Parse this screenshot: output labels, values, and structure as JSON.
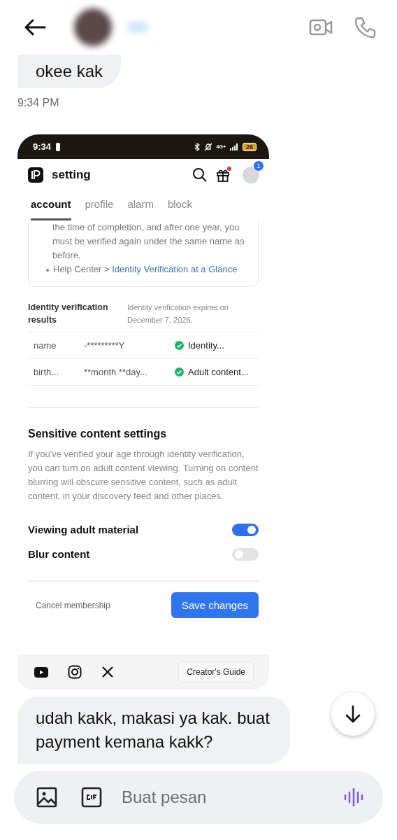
{
  "messages": [
    {
      "kind": "text",
      "text": "okee kak",
      "cut_top": true
    },
    {
      "kind": "time",
      "text": "9:34 PM"
    },
    {
      "kind": "screenshot"
    },
    {
      "kind": "text",
      "text": "udah kakk, makasi ya kak. buat payment kemana kakk?",
      "cut_top": false
    }
  ],
  "screenshot": {
    "status_bar": {
      "time": "9:34",
      "network": "4G+",
      "battery": "26"
    },
    "app_bar": {
      "title": "setting",
      "gift_notification": true,
      "profile_badge": "1"
    },
    "tabs": [
      {
        "label": "account",
        "selected": true
      },
      {
        "label": "profile",
        "selected": false
      },
      {
        "label": "alarm",
        "selected": false
      },
      {
        "label": "block",
        "selected": false
      }
    ],
    "notice_text": "the time of completion, and after one year, you must be verified again under the same name as before.",
    "help_link": {
      "prefix": "Help Center >",
      "link": "Identity Verification at a Glance"
    },
    "verification": {
      "title": "Identity verification results",
      "note": "Identity verification expires on December 7, 2026.",
      "rows": [
        {
          "field": "name",
          "value": "-*********Y",
          "status": "Identity...",
          "verified": true
        },
        {
          "field": "birth...",
          "value": "**month **day...",
          "status": "Adult content...",
          "verified": true
        }
      ]
    },
    "sensitive": {
      "title": "Sensitive content settings",
      "description": "If you've verified your age through identity verification, you can turn on adult content viewing. Turning on content blurring will obscure sensitive content, such as adult content, in your discovery feed and other places.",
      "toggles": [
        {
          "label": "Viewing adult material",
          "on": true
        },
        {
          "label": "Blur content",
          "on": false
        }
      ]
    },
    "actions": {
      "cancel": "Cancel membership",
      "save": "Save changes"
    },
    "footer": {
      "guide": "Creator's Guide"
    }
  },
  "composer": {
    "placeholder": "Buat pesan"
  }
}
